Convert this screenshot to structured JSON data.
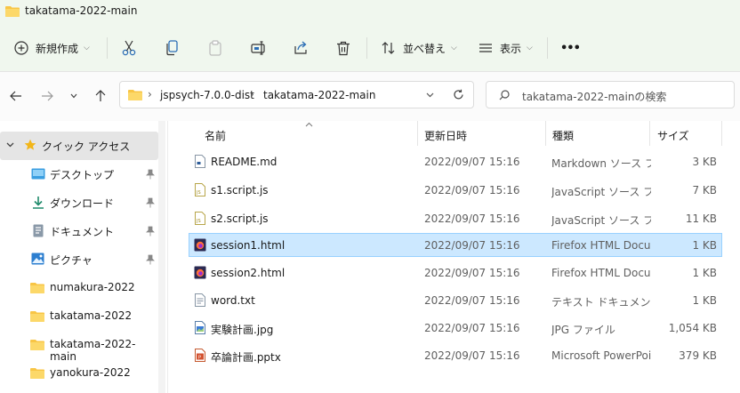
{
  "window": {
    "title": "takatama-2022-main"
  },
  "toolbar": {
    "new_label": "新規作成",
    "sort_label": "並べ替え",
    "view_label": "表示",
    "more_label": "•••"
  },
  "address": {
    "breadcrumb": [
      "jspsych-7.0.0-dist",
      "takatama-2022-main"
    ],
    "separator": "›"
  },
  "search": {
    "placeholder": "takatama-2022-mainの検索"
  },
  "sidebar": {
    "quick_access": "クイック アクセス",
    "items": [
      {
        "label": "デスクトップ",
        "icon": "desktop-icon",
        "pinned": true
      },
      {
        "label": "ダウンロード",
        "icon": "download-icon",
        "pinned": true
      },
      {
        "label": "ドキュメント",
        "icon": "document-icon",
        "pinned": true
      },
      {
        "label": "ピクチャ",
        "icon": "pictures-icon",
        "pinned": true
      },
      {
        "label": "numakura-2022",
        "icon": "folder-icon",
        "pinned": false
      },
      {
        "label": "takatama-2022",
        "icon": "folder-icon",
        "pinned": false
      },
      {
        "label": "takatama-2022-main",
        "icon": "folder-icon",
        "pinned": false
      },
      {
        "label": "yanokura-2022",
        "icon": "folder-icon",
        "pinned": false
      }
    ]
  },
  "columns": {
    "name": "名前",
    "date": "更新日時",
    "type": "種類",
    "size": "サイズ"
  },
  "files": [
    {
      "name": "README.md",
      "date": "2022/09/07 15:16",
      "type": "Markdown ソース ファイル",
      "size": "3 KB",
      "icon": "markdown-file-icon",
      "selected": false
    },
    {
      "name": "s1.script.js",
      "date": "2022/09/07 15:16",
      "type": "JavaScript ソース ファイル",
      "size": "7 KB",
      "icon": "js-file-icon",
      "selected": false
    },
    {
      "name": "s2.script.js",
      "date": "2022/09/07 15:16",
      "type": "JavaScript ソース ファイル",
      "size": "11 KB",
      "icon": "js-file-icon",
      "selected": false
    },
    {
      "name": "session1.html",
      "date": "2022/09/07 15:16",
      "type": "Firefox HTML Document",
      "size": "1 KB",
      "icon": "firefox-html-icon",
      "selected": true
    },
    {
      "name": "session2.html",
      "date": "2022/09/07 15:16",
      "type": "Firefox HTML Document",
      "size": "1 KB",
      "icon": "firefox-html-icon",
      "selected": false
    },
    {
      "name": "word.txt",
      "date": "2022/09/07 15:16",
      "type": "テキスト ドキュメント",
      "size": "1 KB",
      "icon": "text-file-icon",
      "selected": false
    },
    {
      "name": "実験計画.jpg",
      "date": "2022/09/07 15:16",
      "type": "JPG ファイル",
      "size": "1,054 KB",
      "icon": "image-file-icon",
      "selected": false
    },
    {
      "name": "卒論計画.pptx",
      "date": "2022/09/07 15:16",
      "type": "Microsoft PowerPoint",
      "size": "379 KB",
      "icon": "pptx-file-icon",
      "selected": false
    }
  ],
  "colors": {
    "accent": "#0067c0",
    "selection": "#cce8ff",
    "folder": "#f8c545",
    "toolbar_bg": "#f0f7ee"
  }
}
